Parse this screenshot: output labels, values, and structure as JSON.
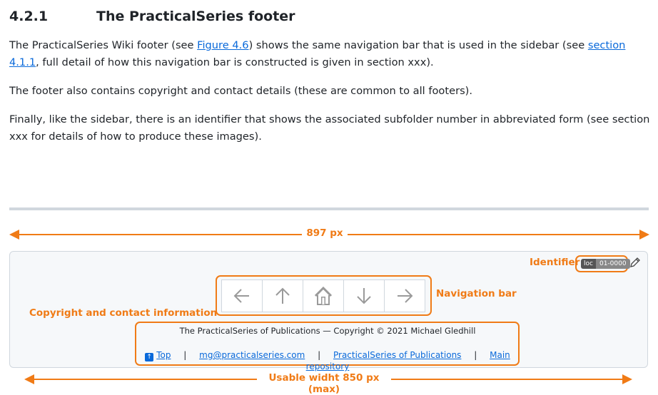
{
  "section": {
    "number": "4.2.1",
    "title": "The PracticalSeries footer"
  },
  "paragraphs": {
    "p1_before_fig": "The PracticalSeries Wiki footer (see ",
    "p1_fig_link": "Figure 4.6",
    "p1_mid": ") shows the same navigation bar that is used in the sidebar (see ",
    "p1_sec_link": "section 4.1.1",
    "p1_after": ", full detail of how this navigation bar is constructed is given in section xxx).",
    "p2": "The footer also contains copyright and contact details (these are common to all footers).",
    "p3": "Finally, like the sidebar, there is an identifier that shows the associated subfolder number in abbreviated form (see section xxx for details of how to produce these images)."
  },
  "annotations": {
    "width_label": "897 px",
    "usable_label": "Usable widht 850 px (max)",
    "identifier_label": "Identifier",
    "navbar_label": "Navigation bar",
    "copyright_label": "Copyright and contact information"
  },
  "identifier": {
    "loc": "loc",
    "code": "01-0000"
  },
  "navigation": {
    "buttons": [
      {
        "name": "previous",
        "icon": "arrow-left-icon"
      },
      {
        "name": "up",
        "icon": "arrow-up-icon"
      },
      {
        "name": "home",
        "icon": "home-icon"
      },
      {
        "name": "down",
        "icon": "arrow-down-icon"
      },
      {
        "name": "next",
        "icon": "arrow-right-icon"
      }
    ]
  },
  "footer": {
    "copyright": "The PracticalSeries of Publications — Copyright © 2021 Michael Gledhill",
    "top_link": "Top",
    "email": "mg@practicalseries.com",
    "publications_link": "PracticalSeries of Publications",
    "repo_link": "Main repository",
    "separator": "|"
  },
  "colors": {
    "accent": "#f07b16",
    "link": "#0969da",
    "footer_bg": "#f6f8fa"
  }
}
